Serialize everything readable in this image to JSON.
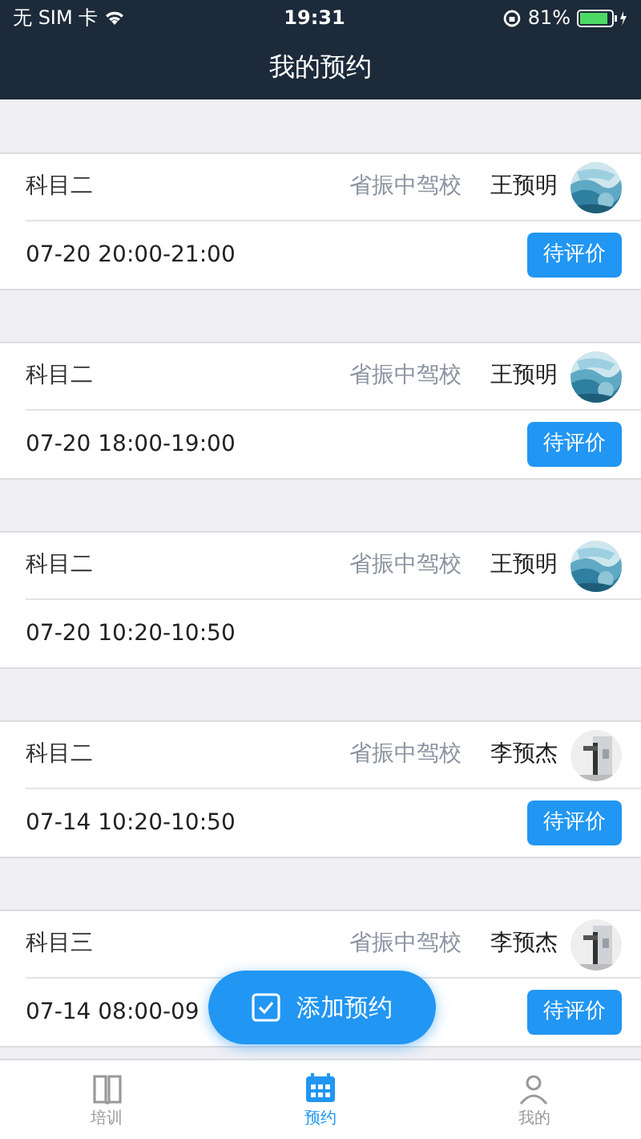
{
  "status_bar": {
    "carrier": "无 SIM 卡",
    "time": "19:31",
    "battery": "81%"
  },
  "title": "我的预约",
  "appointments": [
    {
      "subject": "科目二",
      "school": "省振中驾校",
      "coach": "王预明",
      "time": "07-20 20:00-21:00",
      "action": "待评价"
    },
    {
      "subject": "科目二",
      "school": "省振中驾校",
      "coach": "王预明",
      "time": "07-20 18:00-19:00",
      "action": "待评价"
    },
    {
      "subject": "科目二",
      "school": "省振中驾校",
      "coach": "王预明",
      "time": "07-20 10:20-10:50"
    },
    {
      "subject": "科目二",
      "school": "省振中驾校",
      "coach": "李预杰",
      "time": "07-14 10:20-10:50",
      "action": "待评价"
    },
    {
      "subject": "科目三",
      "school": "省振中驾校",
      "coach": "李预杰",
      "time": "07-14 08:00-09",
      "action": "待评价"
    }
  ],
  "add_button": "添加预约",
  "tabs": [
    {
      "label": "培训",
      "kind": "book",
      "selected": false
    },
    {
      "label": "预约",
      "kind": "calendar",
      "selected": true
    },
    {
      "label": "我的",
      "kind": "person",
      "selected": false
    }
  ]
}
